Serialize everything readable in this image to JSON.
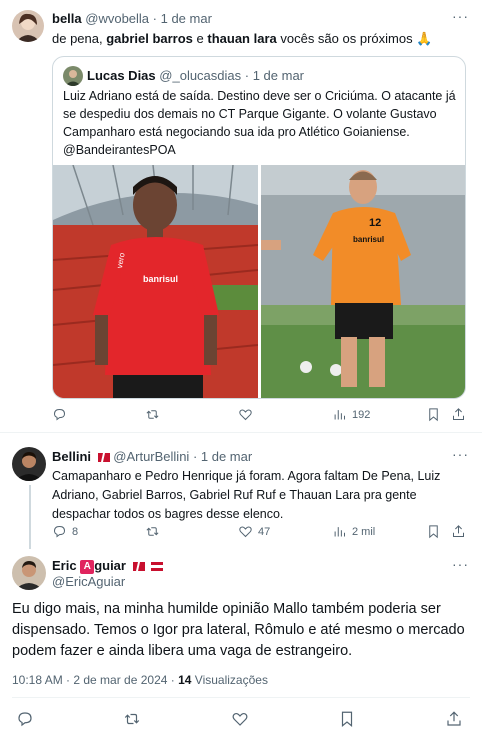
{
  "tweet1": {
    "name": "bella",
    "handle": "@wvobella",
    "time": "· 1 de mar",
    "text_prefix": "de pena, ",
    "mention1": "gabriel barros",
    "text_mid": " e ",
    "mention2": "thauan lara",
    "text_suffix": " vocês são os próximos 🙏",
    "quote": {
      "name": "Lucas Dias",
      "handle": "@_olucasdias",
      "time": "· 1 de mar",
      "text": "Luiz Adriano está de saída. Destino deve ser o Criciúma. O atacante já se despediu dos demais no CT Parque Gigante. O volante Gustavo Campanharo está negociando sua ida pro Atlético Goianiense. @BandeirantesPOA",
      "jersey_text": "banrisul",
      "jersey_brand": "vero",
      "jersey_number": "12"
    },
    "actions": {
      "reply": "",
      "retweet": "",
      "like": "",
      "views": "192"
    }
  },
  "tweet2": {
    "name": "Bellini",
    "handle": "@ArturBellini",
    "time": "· 1 de mar",
    "text": "Camapanharo e Pedro Henrique já foram. Agora faltam De Pena, Luiz Adriano, Gabriel Barros, Gabriel Ruf Ruf e Thauan Lara pra gente despachar todos os bagres desse elenco.",
    "actions": {
      "reply": "8",
      "retweet": "",
      "like": "47",
      "views": "2 mil"
    }
  },
  "tweet3": {
    "name_part1": "Eric ",
    "badge": "A",
    "name_part2": "guiar",
    "handle": "@EricAguiar",
    "text": "Eu digo mais, na minha humilde opinião Mallo também poderia ser dispensado. Temos o Igor pra lateral, Rômulo e até mesmo o mercado podem fazer e ainda libera uma vaga de estrangeiro.",
    "timestamp": "10:18 AM · 2 de mar de 2024 · ",
    "views_count": "14",
    "views_label": " Visualizações"
  },
  "colors": {
    "accent": "#1d9bf0",
    "muted": "#536471",
    "border": "#cfd9de",
    "flag_red": "#c8102e"
  }
}
